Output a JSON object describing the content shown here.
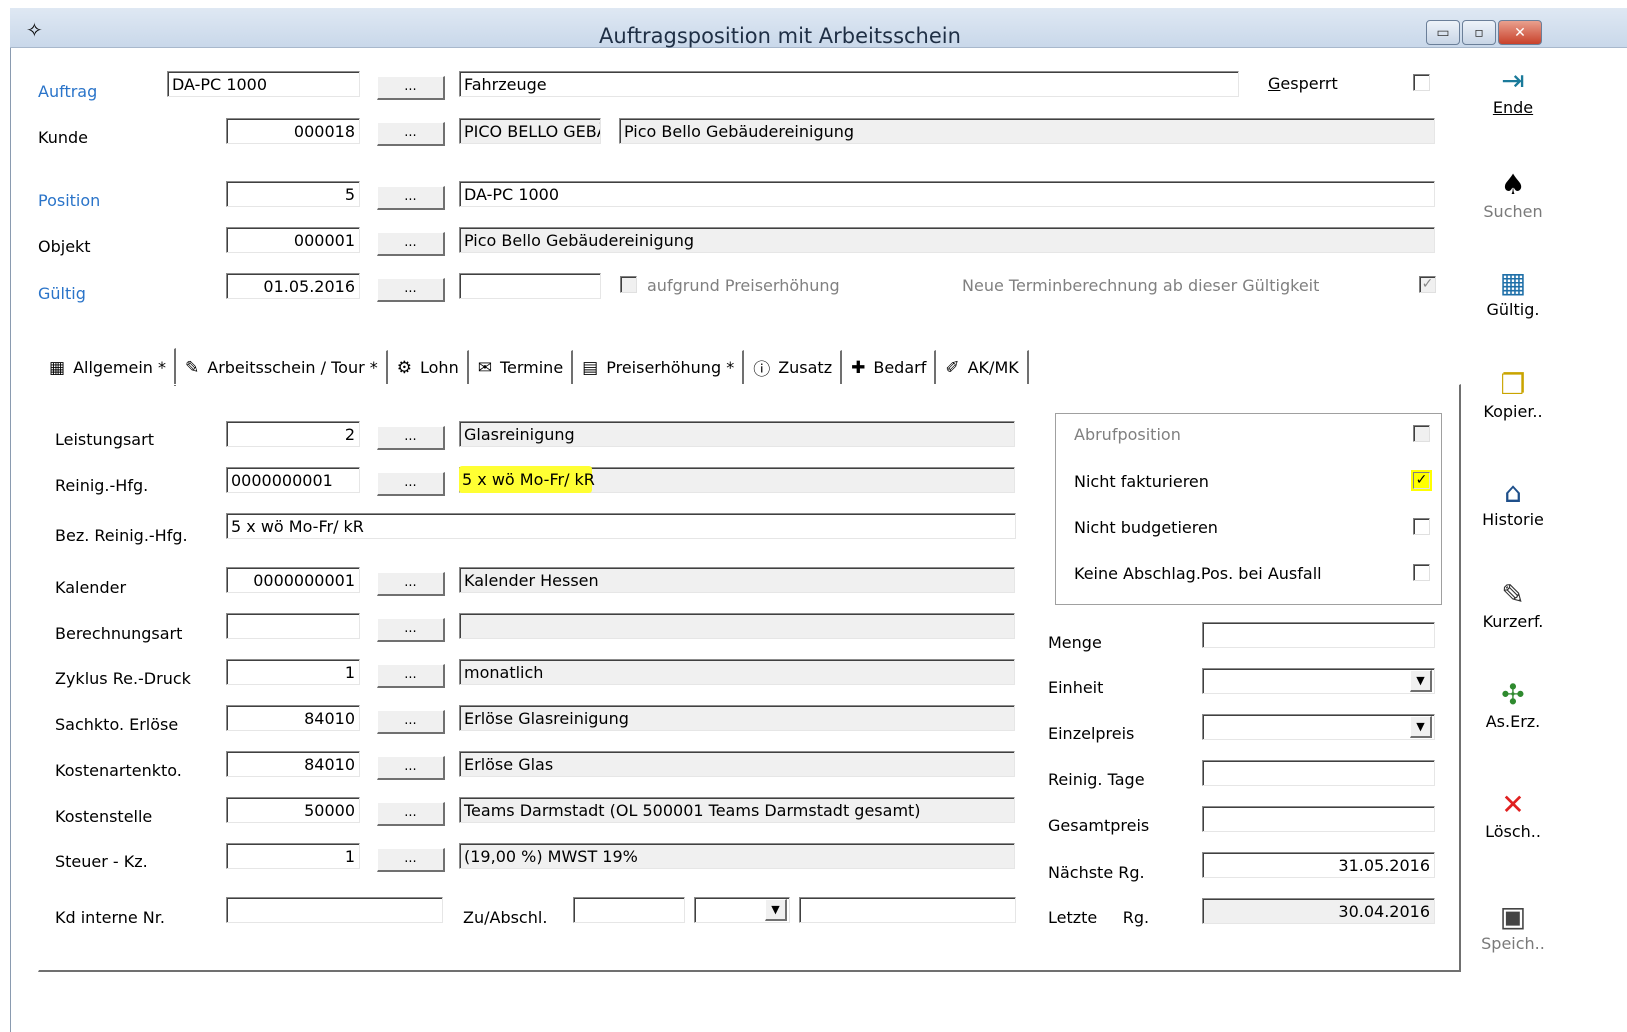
{
  "window": {
    "title": "Auftragsposition mit Arbeitsschein",
    "minimize_glyph": "▭",
    "maximize_glyph": "▫",
    "close_glyph": "✕"
  },
  "header": {
    "auftrag": {
      "label": "Auftrag",
      "value": "DA-PC 1000",
      "desc": "Fahrzeuge"
    },
    "gesperrt": {
      "label": "Gesperrt",
      "checked": false
    },
    "kunde": {
      "label": "Kunde",
      "value": "000018",
      "short": "PICO BELLO GEBÄ",
      "desc": "Pico Bello Gebäudereinigung"
    },
    "position": {
      "label": "Position",
      "value": "5",
      "desc": "DA-PC 1000"
    },
    "objekt": {
      "label": "Objekt",
      "value": "000001",
      "desc": "Pico Bello Gebäudereinigung"
    },
    "gueltig": {
      "label": "Gültig",
      "value": "01.05.2016",
      "extra": "",
      "preis_label": "aufgrund Preiserhöhung",
      "termin_label": "Neue Terminberechnung ab dieser Gültigkeit",
      "termin_checked": true
    },
    "dots_label": "..."
  },
  "tabs": [
    {
      "label": "Allgemein *",
      "icon": "▦"
    },
    {
      "label": "Arbeitsschein / Tour *",
      "icon": "✎"
    },
    {
      "label": "Lohn",
      "icon": "⚙"
    },
    {
      "label": "Termine",
      "icon": "✉"
    },
    {
      "label": "Preiserhöhung *",
      "icon": "▤"
    },
    {
      "label": "Zusatz",
      "icon": "ⓘ"
    },
    {
      "label": "Bedarf",
      "icon": "✚"
    },
    {
      "label": "AK/MK",
      "icon": "✐"
    }
  ],
  "allgemein": {
    "leistungsart": {
      "label": "Leistungsart",
      "value": "2",
      "desc": "Glasreinigung"
    },
    "reinig_hfg": {
      "label": "Reinig.-Hfg.",
      "value": "0000000001",
      "desc": "5 x wö Mo-Fr/ kR"
    },
    "bez_reinig_hfg": {
      "label": "Bez. Reinig.-Hfg.",
      "value": "5 x wö Mo-Fr/ kR"
    },
    "kalender": {
      "label": "Kalender",
      "value": "0000000001",
      "desc": "Kalender Hessen"
    },
    "berechnungsart": {
      "label": "Berechnungsart",
      "value": "",
      "desc": ""
    },
    "zyklus": {
      "label": "Zyklus Re.-Druck",
      "value": "1",
      "desc": "monatlich"
    },
    "sachkto": {
      "label": "Sachkto. Erlöse",
      "value": "84010",
      "desc": "Erlöse Glasreinigung"
    },
    "kostenartenkto": {
      "label": "Kostenartenkto.",
      "value": "84010",
      "desc": "Erlöse Glas"
    },
    "kostenstelle": {
      "label": "Kostenstelle",
      "value": "50000",
      "desc": "Teams  Darmstadt (OL 500001 Teams Darmstadt gesamt)"
    },
    "steuer": {
      "label": "Steuer - Kz.",
      "value": "1",
      "desc": "(19,00 %)  MWST 19%"
    },
    "kd_interne": {
      "label": "Kd interne Nr.",
      "value": ""
    },
    "zu_abschl": {
      "label": "Zu/Abschl.",
      "value1": "",
      "value2": "",
      "value3": ""
    }
  },
  "options": {
    "abrufposition": {
      "label": "Abrufposition",
      "checked": false
    },
    "nicht_fakturieren": {
      "label": "Nicht fakturieren",
      "checked": true
    },
    "nicht_budgetieren": {
      "label": "Nicht budgetieren",
      "checked": false
    },
    "keine_abschlag": {
      "label": "Keine Abschlag.Pos. bei Ausfall",
      "checked": false
    }
  },
  "pricing": {
    "menge": {
      "label": "Menge",
      "value": ""
    },
    "einheit": {
      "label": "Einheit",
      "value": ""
    },
    "einzelpreis": {
      "label": "Einzelpreis",
      "value": ""
    },
    "reinig_tage": {
      "label": "Reinig. Tage",
      "value": ""
    },
    "gesamtpreis": {
      "label": "Gesamtpreis",
      "value": ""
    },
    "naechste_rg": {
      "label": "Nächste Rg.",
      "value": "31.05.2016"
    },
    "letzte_rg": {
      "label": "Letzte     Rg.",
      "value": "30.04.2016"
    }
  },
  "sidebar": [
    {
      "label": "Ende",
      "icon": "exit-door-icon",
      "glyph": "⇥"
    },
    {
      "label": "Suchen",
      "icon": "binoculars-icon",
      "glyph": "♠"
    },
    {
      "label": "Gültig.",
      "icon": "calendar-icon",
      "glyph": "▦"
    },
    {
      "label": "Kopier..",
      "icon": "copy-icon",
      "glyph": "❐"
    },
    {
      "label": "Historie",
      "icon": "building-icon",
      "glyph": "⌂"
    },
    {
      "label": "Kurzerf.",
      "icon": "edit-icon",
      "glyph": "✎"
    },
    {
      "label": "As.Erz.",
      "icon": "generate-icon",
      "glyph": "✣"
    },
    {
      "label": "Lösch..",
      "icon": "delete-icon",
      "glyph": "✕"
    },
    {
      "label": "Speich..",
      "icon": "save-icon",
      "glyph": "▣"
    }
  ],
  "colors": {
    "link": "#2a74c9",
    "highlight": "#ffff33",
    "delete": "#e02020"
  }
}
